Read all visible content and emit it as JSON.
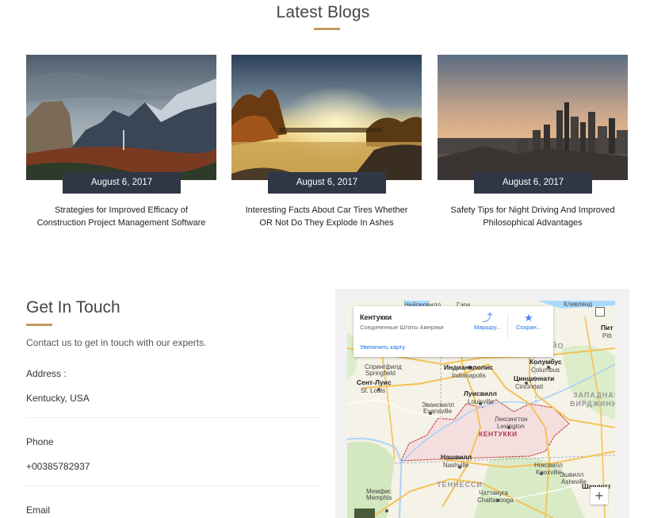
{
  "blogs": {
    "title": "Latest Blogs",
    "posts": [
      {
        "date": "August 6, 2017",
        "title": "Strategies for Improved Efficacy of Construction Project Management Software"
      },
      {
        "date": "August 6, 2017",
        "title": "Interesting Facts About Car Tires Whether OR Not Do They Explode In Ashes"
      },
      {
        "date": "August 6, 2017",
        "title": "Safety Tips for Night Driving And Improved Philosophical Advantages"
      }
    ]
  },
  "contact": {
    "title": "Get In Touch",
    "intro": "Contact us to get in touch with our experts.",
    "address_label": "Address :",
    "address_value": "Kentucky, USA",
    "phone_label": "Phone",
    "phone_value": "+00385782937",
    "email_label": "Email"
  },
  "map": {
    "place_name": "Кентукки",
    "place_sub": "Соединенные Штаты Америки",
    "directions_label": "Маршру...",
    "save_label": "Сохран...",
    "enlarge_label": "Увеличить карту",
    "zoom_in": "+",
    "labels": {
      "neiperville": "Нейпервилл",
      "gary": "Гэри",
      "cleveland": "Кливленд",
      "pitt": "Пит",
      "pitt2": "Pitt",
      "ohio": "ЙО",
      "springfield_ru": "Спрингфилд",
      "springfield": "Springfield",
      "indianapolis_ru": "Индианаполис",
      "indianapolis": "Indianapolis",
      "columbus_ru": "Колумбус",
      "columbus": "Columbus",
      "cincinnati_ru": "Цинциннати",
      "cincinnati": "Cincinnati",
      "stlouis_ru": "Сент-Луис",
      "stlouis": "St. Louis",
      "louisville_ru": "Луисвилл",
      "louisville": "Louisville",
      "evansville_ru": "Эвансвилл",
      "evansville": "Evansville",
      "lexington_ru": "Лексингтон",
      "lexington": "Lexington",
      "wv1": "ЗАПАДНАЯ",
      "wv2": "ВИРДЖИНИ",
      "kentucky": "КЕНТУККИ",
      "nashville_ru": "Нашвилл",
      "nashville": "Nashville",
      "knoxville_ru": "Ноксвилл",
      "knoxville": "Knoxville",
      "tennessee": "ТЕННЕССИ",
      "memphis_ru": "Мемфис",
      "memphis": "Memphis",
      "chattanooga_ru": "Чаттануга",
      "chattanooga": "Chattanooga",
      "asheville_ru": "Эшвилл",
      "asheville": "Asheville",
      "charlotte_ru": "Шарлотт"
    }
  },
  "colors": {
    "accent": "#c39a63",
    "date_badge": "#2f3747",
    "kentucky_fill": "#f3dede",
    "kentucky_border": "#c0504d"
  }
}
